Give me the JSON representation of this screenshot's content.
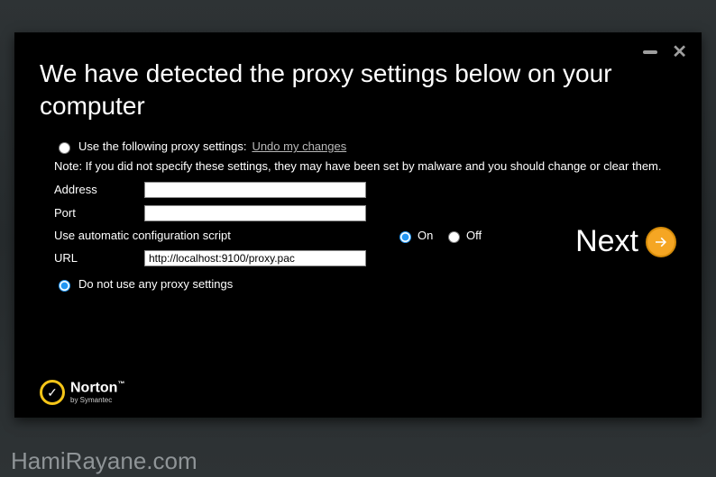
{
  "heading": "We have detected the proxy settings below on your computer",
  "options": {
    "use_label": "Use the following proxy settings:",
    "undo_label": "Undo my changes",
    "note": "Note: If you did not specify these settings, they may have been set by malware and you should change or clear them.",
    "address_label": "Address",
    "address_value": "",
    "port_label": "Port",
    "port_value": "",
    "script_label": "Use automatic configuration script",
    "on_label": "On",
    "off_label": "Off",
    "url_label": "URL",
    "url_value": "http://localhost:9100/proxy.pac",
    "no_proxy_label": "Do not use any proxy settings"
  },
  "next_label": "Next",
  "brand": {
    "name": "Norton",
    "tm": "™",
    "by": "by Symantec"
  },
  "watermark": "HamiRayane.com"
}
